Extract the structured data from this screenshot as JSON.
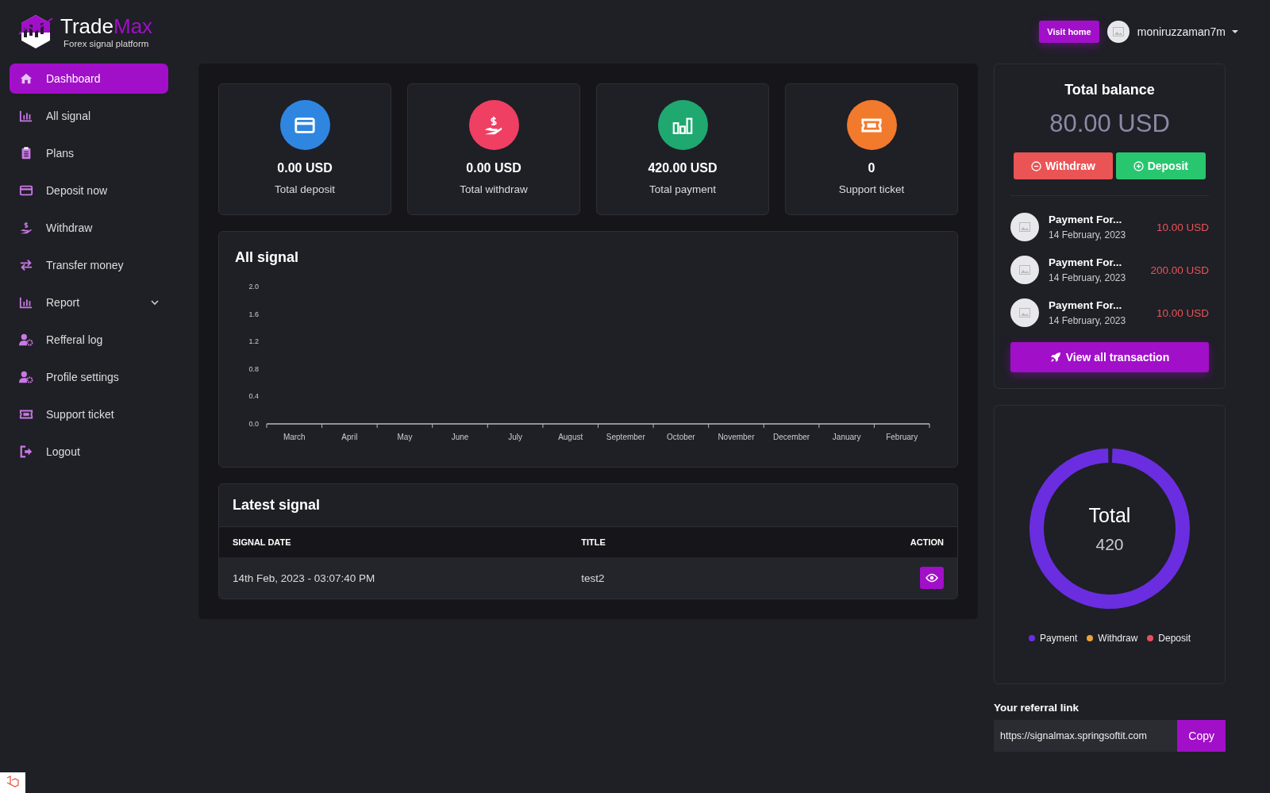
{
  "logo": {
    "name_start": "Trade",
    "name_end": "Max",
    "tagline": "Forex signal platform"
  },
  "topbar": {
    "visit_button": "Visit home",
    "username": "moniruzzaman7m"
  },
  "sidebar": {
    "items": [
      {
        "label": "Dashboard",
        "selected": true
      },
      {
        "label": "All signal",
        "selected": false
      },
      {
        "label": "Plans",
        "selected": false
      },
      {
        "label": "Deposit now",
        "selected": false
      },
      {
        "label": "Withdraw",
        "selected": false
      },
      {
        "label": "Transfer money",
        "selected": false
      },
      {
        "label": "Report",
        "selected": false,
        "kind": "dropdown",
        "expanded": false
      },
      {
        "label": "Refferal log",
        "selected": false
      },
      {
        "label": "Profile settings",
        "selected": false
      },
      {
        "label": "Support ticket",
        "selected": false
      },
      {
        "label": "Logout",
        "selected": false
      }
    ]
  },
  "stats": [
    {
      "value": "0.00 USD",
      "label": "Total deposit",
      "color": "#2f86e0"
    },
    {
      "value": "0.00 USD",
      "label": "Total withdraw",
      "color": "#ef3f62"
    },
    {
      "value": "420.00 USD",
      "label": "Total payment",
      "color": "#1fa86f"
    },
    {
      "value": "0",
      "label": "Support ticket",
      "color": "#f27a2c"
    }
  ],
  "signal_chart": {
    "title": "All signal",
    "chart_data": {
      "type": "line",
      "categories": [
        "March",
        "April",
        "May",
        "June",
        "July",
        "August",
        "September",
        "October",
        "November",
        "December",
        "January",
        "February"
      ],
      "ylim": [
        0,
        2
      ],
      "yticks": [
        {
          "value": 0,
          "label": "0.0"
        },
        {
          "value": 0.4,
          "label": "0.4"
        },
        {
          "value": 0.8,
          "label": "0.8"
        },
        {
          "value": 1.2,
          "label": "1.2"
        },
        {
          "value": 1.6,
          "label": "1.6"
        },
        {
          "value": 2,
          "label": "2.0"
        }
      ]
    }
  },
  "latest_signal": {
    "title": "Latest signal",
    "columns": [
      "SIGNAL DATE",
      "TITLE",
      "ACTION"
    ],
    "rows": [
      {
        "date": "14th Feb, 2023 - 03:07:40 PM",
        "title": "test2"
      }
    ]
  },
  "balance": {
    "title": "Total balance",
    "amount": "80.00 USD",
    "withdraw_button": "Withdraw",
    "deposit_button": "Deposit",
    "transactions": [
      {
        "title": "Payment For...",
        "date": "14 February, 2023",
        "amount": "10.00 USD"
      },
      {
        "title": "Payment For...",
        "date": "14 February, 2023",
        "amount": "200.00 USD"
      },
      {
        "title": "Payment For...",
        "date": "14 February, 2023",
        "amount": "10.00 USD"
      }
    ],
    "view_all_button": "View all transaction"
  },
  "total_chart": {
    "title": "Total",
    "value": "420",
    "legend": [
      {
        "label": "Payment",
        "color": "#6a2ee0"
      },
      {
        "label": "Withdraw",
        "color": "#e8a33d"
      },
      {
        "label": "Deposit",
        "color": "#e8505b"
      }
    ]
  },
  "referral": {
    "label": "Your referral link",
    "value": "https://signalmax.springsoftit.com",
    "copy_button": "Copy"
  }
}
